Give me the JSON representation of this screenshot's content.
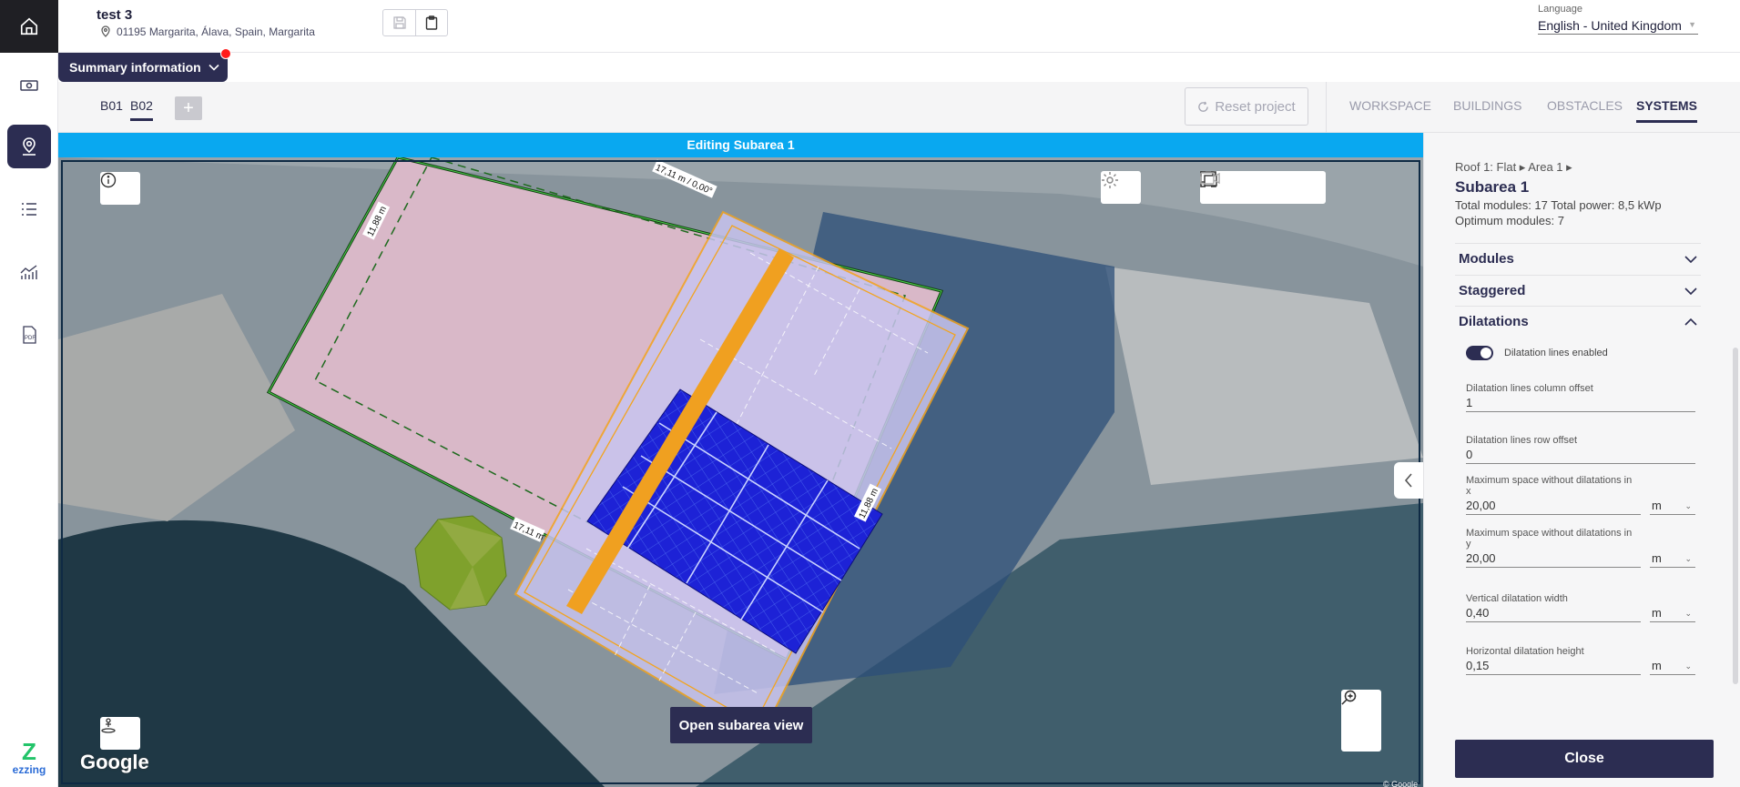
{
  "header": {
    "project_title": "test 3",
    "project_address": "01195 Margarita, Álava, Spain, Margarita",
    "language_label": "Language",
    "language_value": "English - United Kingdom"
  },
  "summary": {
    "label": "Summary information"
  },
  "building_tabs": [
    {
      "label": "B01"
    },
    {
      "label": "B02"
    }
  ],
  "toolbar": {
    "reset_label": "Reset project",
    "main_tabs": [
      {
        "label": "WORKSPACE"
      },
      {
        "label": "BUILDINGS"
      },
      {
        "label": "OBSTACLES"
      },
      {
        "label": "SYSTEMS"
      }
    ]
  },
  "map": {
    "editing_banner": "Editing Subarea 1",
    "dimension_labels": {
      "top": "17,11 m / 0,00°",
      "left": "11,88 m",
      "right": "11,88 m",
      "bottom": "17,11 m"
    },
    "open_subarea_label": "Open subarea view",
    "attribution": "Google",
    "copyright": "© Google"
  },
  "panel": {
    "breadcrumb": "Roof 1: Flat ▸ Area 1 ▸",
    "title": "Subarea 1",
    "info_line1": "Total modules: 17 Total power: 8,5 kWp",
    "info_line2": "Optimum modules: 7",
    "sections": [
      {
        "label": "Modules"
      },
      {
        "label": "Staggered"
      },
      {
        "label": "Dilatations"
      }
    ],
    "toggle_label": "Dilatation lines enabled",
    "fields": {
      "col_offset": {
        "label": "Dilatation lines column offset",
        "value": "1"
      },
      "row_offset": {
        "label": "Dilatation lines row offset",
        "value": "0"
      },
      "max_x": {
        "label": "Maximum space without dilatations in x",
        "value": "20,00",
        "unit": "m"
      },
      "max_y": {
        "label": "Maximum space without dilatations in y",
        "value": "20,00",
        "unit": "m"
      },
      "vert_width": {
        "label": "Vertical dilatation width",
        "value": "0,40",
        "unit": "m"
      },
      "horiz_height": {
        "label": "Horizontal dilatation height",
        "value": "0,15",
        "unit": "m"
      }
    },
    "close_label": "Close"
  },
  "brand": {
    "logo_text": "ezzing"
  },
  "colors": {
    "accent": "#2c2d52",
    "banner": "#09a8f0",
    "module_blue": "#1d22d6",
    "dilatation_orange": "#f0a020",
    "notify_red": "#ff1a1a"
  }
}
